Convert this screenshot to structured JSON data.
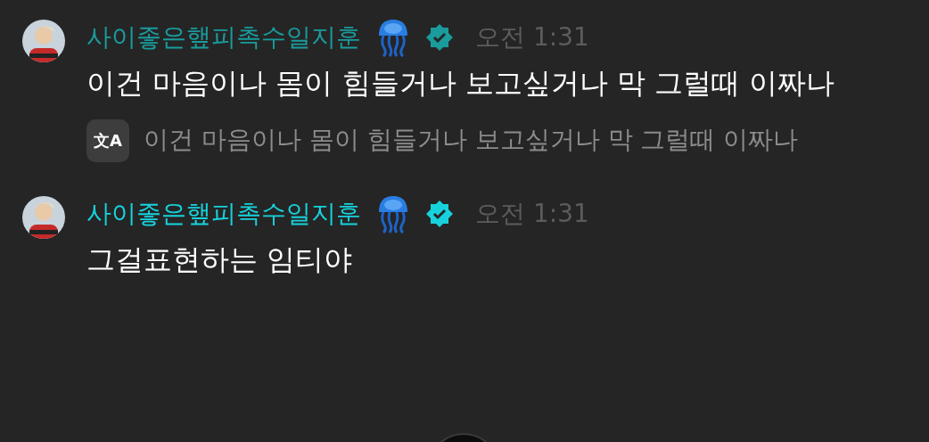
{
  "messages": [
    {
      "author": "사이좋은햎피촉수일지훈",
      "color": "#1a9b9c",
      "verified": true,
      "time": "오전 1:31",
      "text": "이건 마음이나 몸이 힘들거나 보고싶거나 막 그럴때 이짜나",
      "translation": {
        "icon": "文A",
        "text": "이건 마음이나 몸이 힘들거나 보고싶거나 막 그럴때 이짜나"
      }
    },
    {
      "author": "사이좋은햎피촉수일지훈",
      "color": "#17d2dc",
      "verified": true,
      "time": "오전 1:31",
      "text": "그걸표현하는 임티야"
    }
  ]
}
